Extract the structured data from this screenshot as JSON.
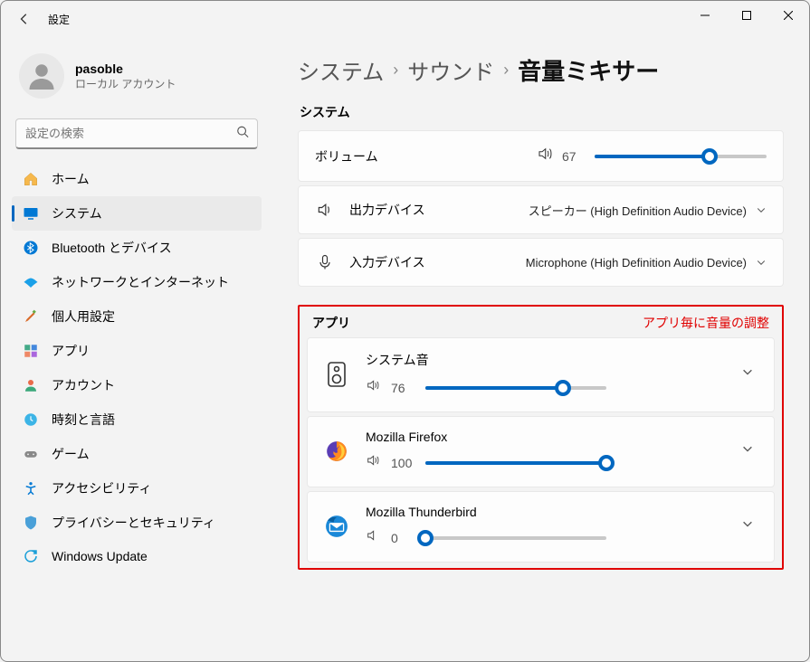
{
  "window": {
    "title": "設定"
  },
  "user": {
    "name": "pasoble",
    "sub": "ローカル アカウント"
  },
  "search": {
    "placeholder": "設定の検索"
  },
  "nav": {
    "items": [
      {
        "label": "ホーム"
      },
      {
        "label": "システム"
      },
      {
        "label": "Bluetooth とデバイス"
      },
      {
        "label": "ネットワークとインターネット"
      },
      {
        "label": "個人用設定"
      },
      {
        "label": "アプリ"
      },
      {
        "label": "アカウント"
      },
      {
        "label": "時刻と言語"
      },
      {
        "label": "ゲーム"
      },
      {
        "label": "アクセシビリティ"
      },
      {
        "label": "プライバシーとセキュリティ"
      },
      {
        "label": "Windows Update"
      }
    ],
    "active_index": 1
  },
  "breadcrumb": {
    "c0": "システム",
    "c1": "サウンド",
    "current": "音量ミキサー"
  },
  "system_section": {
    "title": "システム",
    "volume": {
      "label": "ボリューム",
      "value": 67
    },
    "output": {
      "label": "出力デバイス",
      "value": "スピーカー (High Definition Audio Device)"
    },
    "input": {
      "label": "入力デバイス",
      "value": "Microphone (High Definition Audio Device)"
    }
  },
  "app_section": {
    "title": "アプリ",
    "annotation": "アプリ毎に音量の調整",
    "items": [
      {
        "name": "システム音",
        "volume": 76
      },
      {
        "name": "Mozilla Firefox",
        "volume": 100
      },
      {
        "name": "Mozilla Thunderbird",
        "volume": 0
      }
    ]
  }
}
